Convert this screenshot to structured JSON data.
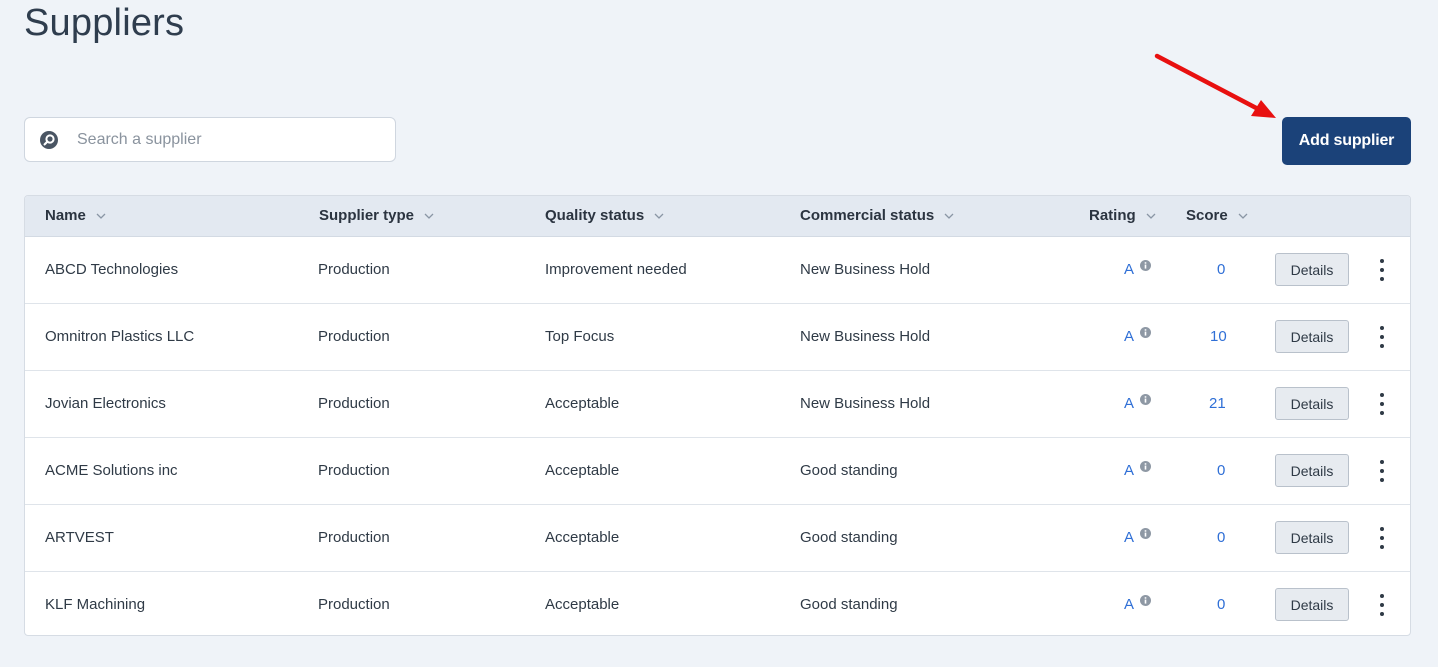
{
  "page": {
    "title": "Suppliers"
  },
  "search": {
    "placeholder": "Search a supplier",
    "value": ""
  },
  "toolbar": {
    "add_label": "Add supplier"
  },
  "colors": {
    "primary_button": "#1b4279",
    "link_blue": "#2f6fd6",
    "annotation_arrow": "#e81010"
  },
  "table": {
    "columns": [
      {
        "key": "name",
        "label": "Name"
      },
      {
        "key": "supplier_type",
        "label": "Supplier type"
      },
      {
        "key": "quality_status",
        "label": "Quality status"
      },
      {
        "key": "commercial_status",
        "label": "Commercial status"
      },
      {
        "key": "rating",
        "label": "Rating"
      },
      {
        "key": "score",
        "label": "Score"
      }
    ],
    "details_label": "Details",
    "rows": [
      {
        "name": "ABCD Technologies",
        "supplier_type": "Production",
        "quality_status": "Improvement needed",
        "commercial_status": "New Business Hold",
        "rating": "A",
        "score": "0"
      },
      {
        "name": "Omnitron Plastics LLC",
        "supplier_type": "Production",
        "quality_status": "Top Focus",
        "commercial_status": "New Business Hold",
        "rating": "A",
        "score": "10"
      },
      {
        "name": "Jovian Electronics",
        "supplier_type": "Production",
        "quality_status": "Acceptable",
        "commercial_status": "New Business Hold",
        "rating": "A",
        "score": "21"
      },
      {
        "name": "ACME Solutions inc",
        "supplier_type": "Production",
        "quality_status": "Acceptable",
        "commercial_status": "Good standing",
        "rating": "A",
        "score": "0"
      },
      {
        "name": "ARTVEST",
        "supplier_type": "Production",
        "quality_status": "Acceptable",
        "commercial_status": "Good standing",
        "rating": "A",
        "score": "0"
      },
      {
        "name": "KLF Machining",
        "supplier_type": "Production",
        "quality_status": "Acceptable",
        "commercial_status": "Good standing",
        "rating": "A",
        "score": "0"
      }
    ]
  }
}
